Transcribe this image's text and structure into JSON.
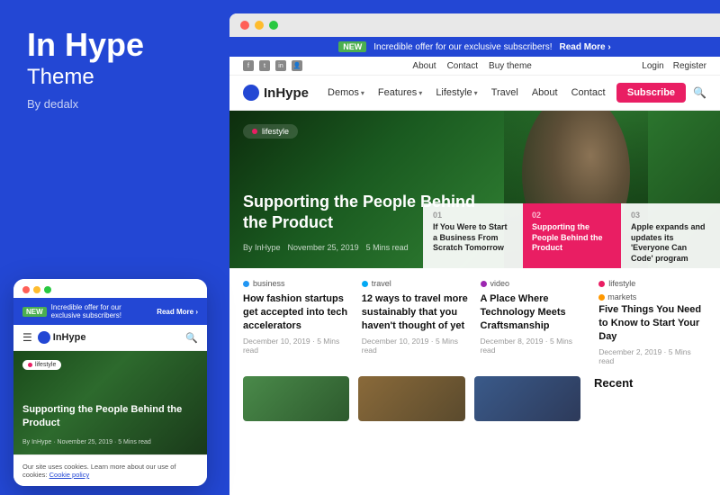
{
  "left": {
    "brand_title": "In Hype",
    "brand_subtitle": "Theme",
    "brand_by": "By dedalx"
  },
  "mockup": {
    "notif": {
      "badge": "NEW",
      "text": "Incredible offer for our exclusive subscribers!",
      "link": "Read More ›"
    },
    "nav": {
      "logo_text": "InHype"
    },
    "hero": {
      "badge": "lifestyle",
      "title": "Supporting the People Behind the Product",
      "meta": "By InHype · November 25, 2019 · 5 Mins read"
    },
    "cookie": {
      "text": "Our site uses cookies. Learn more about our use of cookies:",
      "link_text": "Cookie policy"
    }
  },
  "browser": {
    "notif": {
      "badge": "NEW",
      "text": "Incredible offer for our exclusive subscribers!",
      "link": "Read More ›"
    },
    "top_bar": {
      "center_links": [
        "About",
        "Contact",
        "Buy theme"
      ],
      "right_links": [
        "Login",
        "Register"
      ]
    },
    "nav": {
      "logo": "InHype",
      "items": [
        {
          "label": "Demos",
          "dropdown": true
        },
        {
          "label": "Features",
          "dropdown": true
        },
        {
          "label": "Lifestyle",
          "dropdown": true
        },
        {
          "label": "Travel",
          "dropdown": false
        },
        {
          "label": "About",
          "dropdown": false
        },
        {
          "label": "Contact",
          "dropdown": false
        }
      ],
      "subscribe": "Subscribe"
    },
    "hero": {
      "badge": "lifestyle",
      "title": "Supporting the People Behind the Product",
      "meta_author": "By InHype",
      "meta_date": "November 25, 2019",
      "meta_read": "5 Mins read",
      "cards": [
        {
          "num": "01",
          "title": "If You Were to Start a Business From Scratch Tomorrow",
          "active": false
        },
        {
          "num": "02",
          "title": "Supporting the People Behind the Product",
          "active": true
        },
        {
          "num": "03",
          "title": "Apple expands and updates its 'Everyone Can Code' program",
          "active": false
        }
      ]
    },
    "articles": [
      {
        "category": "business",
        "cat_color": "#2196f3",
        "title": "How fashion startups get accepted into tech accelerators",
        "date": "December 10, 2019 · 5 Mins read"
      },
      {
        "category": "travel",
        "cat_color": "#03a9f4",
        "title": "12 ways to travel more sustainably that you haven't thought of yet",
        "date": "December 10, 2019 · 5 Mins read"
      },
      {
        "category": "video",
        "cat_color": "#9c27b0",
        "title": "A Place Where Technology Meets Craftsmanship",
        "date": "December 8, 2019 · 5 Mins read"
      },
      {
        "category": "lifestyle",
        "cat_color": "#e91e63",
        "title": "Five Things You Need to Know to Start Your Day",
        "date": "December 2, 2019 · 5 Mins read"
      },
      {
        "category": "markets",
        "cat_color": "#ff9800",
        "title": "",
        "date": ""
      }
    ],
    "recent_title": "Recent"
  }
}
